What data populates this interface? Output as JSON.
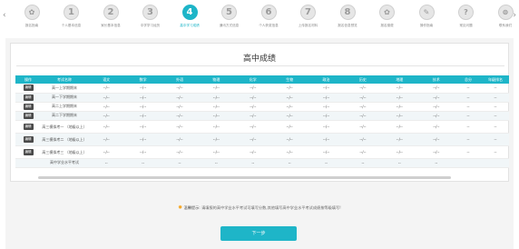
{
  "stepbar": {
    "steps": [
      {
        "num": "✿",
        "label": "报名指南"
      },
      {
        "num": "1",
        "label": "个人基本信息"
      },
      {
        "num": "2",
        "label": "家长基本信息"
      },
      {
        "num": "3",
        "label": "中学学习经历"
      },
      {
        "num": "4",
        "label": "高中学习成绩"
      },
      {
        "num": "5",
        "label": "通讯方式信息"
      },
      {
        "num": "6",
        "label": "个人获奖信息"
      },
      {
        "num": "7",
        "label": "上传报名材料"
      },
      {
        "num": "8",
        "label": "报名信息预览"
      },
      {
        "num": "✿",
        "label": "报名缴费"
      },
      {
        "num": "✎",
        "label": "操作指南"
      },
      {
        "num": "?",
        "label": "常见问题"
      },
      {
        "num": "⊜",
        "label": "联系我们"
      }
    ],
    "active_index": 4
  },
  "section": {
    "title": "高中成绩"
  },
  "table": {
    "headers": [
      "操作",
      "考试名称",
      "语文",
      "数学",
      "外语",
      "物理",
      "化学",
      "生物",
      "政治",
      "历史",
      "地理",
      "技术",
      "总分",
      "年级排名"
    ],
    "rows": [
      {
        "action": "编辑",
        "name": "高一上学期期末",
        "values": [
          "--/--",
          "--/--",
          "--/--",
          "--/--",
          "--/--",
          "--/--",
          "--/--",
          "--/--",
          "--/--",
          "--/--",
          "--",
          "--"
        ]
      },
      {
        "action": "编辑",
        "name": "高一下学期期末",
        "values": [
          "--/--",
          "--/--",
          "--/--",
          "--/--",
          "--/--",
          "--/--",
          "--/--",
          "--/--",
          "--/--",
          "--/--",
          "--",
          "--"
        ]
      },
      {
        "action": "编辑",
        "name": "高二上学期期末",
        "values": [
          "--/--",
          "--/--",
          "--/--",
          "--/--",
          "--/--",
          "--/--",
          "--/--",
          "--/--",
          "--/--",
          "--/--",
          "--",
          "--"
        ]
      },
      {
        "action": "编辑",
        "name": "高二下学期期末",
        "values": [
          "--/--",
          "--/--",
          "--/--",
          "--/--",
          "--/--",
          "--/--",
          "--/--",
          "--/--",
          "--/--",
          "--/--",
          "--",
          "--"
        ]
      },
      {
        "action": "编辑",
        "name": "高三模拟考一 （地级以上）",
        "values": [
          "--/--",
          "--/--",
          "--/--",
          "--/--",
          "--/--",
          "--/--",
          "--/--",
          "--/--",
          "--/--",
          "--/--",
          "--",
          "--"
        ]
      },
      {
        "action": "编辑",
        "name": "高三模拟考二 （地级以上）",
        "values": [
          "--/--",
          "--/--",
          "--/--",
          "--/--",
          "--/--",
          "--/--",
          "--/--",
          "--/--",
          "--/--",
          "--/--",
          "--",
          "--"
        ]
      },
      {
        "action": "编辑",
        "name": "高三模拟考三 （地级以上）",
        "values": [
          "--/--",
          "--/--",
          "--/--",
          "--/--",
          "--/--",
          "--/--",
          "--/--",
          "--/--",
          "--/--",
          "--/--",
          "--",
          "--"
        ]
      },
      {
        "action": "",
        "name": "高中学业水平考试",
        "values": [
          "--",
          "--",
          "--",
          "--",
          "--",
          "--",
          "--",
          "--",
          "--",
          "--",
          "",
          ""
        ]
      }
    ]
  },
  "tip": {
    "prefix": "温馨提示:",
    "text": "请填报的高中学业水平考试可填写分数,其他填写高中学业水平考试成绩按等级填写!"
  },
  "buttons": {
    "next": "下一步"
  },
  "colors": {
    "accent": "#1eb5c8"
  }
}
